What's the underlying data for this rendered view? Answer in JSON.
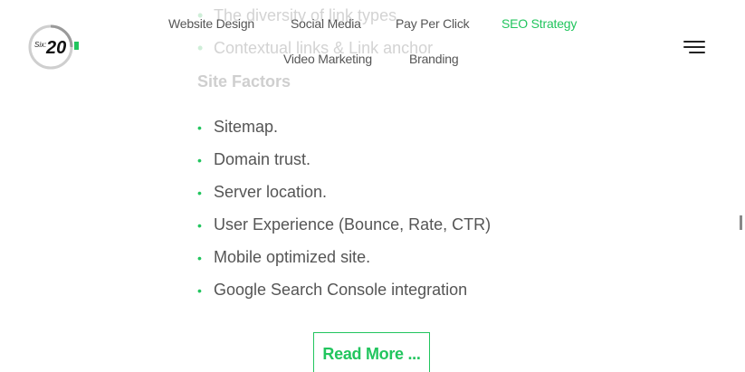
{
  "logo": {
    "text_small": "Six:",
    "text_big": "20",
    "accent_color": "#22c55e"
  },
  "nav": {
    "items": [
      {
        "label": "Website Design"
      },
      {
        "label": "Social Media"
      },
      {
        "label": "Pay Per Click"
      },
      {
        "label": "SEO Strategy"
      },
      {
        "label": "Video Marketing"
      },
      {
        "label": "Branding"
      }
    ],
    "menu_icon": "hamburger-icon",
    "accent_color": "#22c55e"
  },
  "background_content": {
    "item_1": "The diversity of link types.",
    "item_2": "Contextual links & Link anchor",
    "heading": "Site Factors"
  },
  "site_factors": {
    "items": [
      "Sitemap.",
      "Domain trust.",
      "Server location.",
      "User Experience (Bounce, Rate, CTR)",
      "Mobile optimized site.",
      "Google Search Console integration"
    ]
  },
  "cta": {
    "read_more": "Read More ..."
  }
}
